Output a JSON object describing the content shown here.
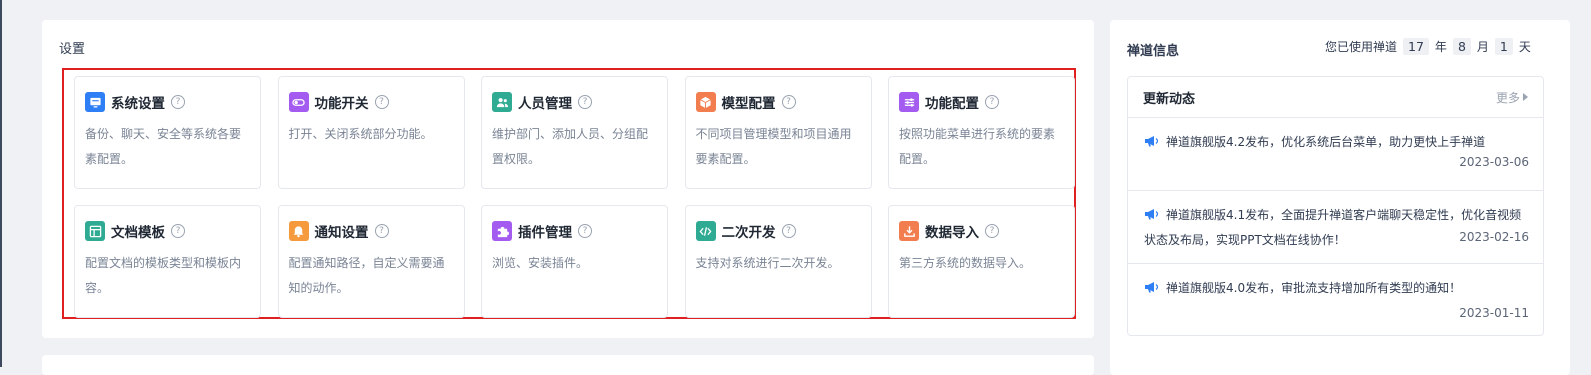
{
  "settings": {
    "title": "设置",
    "cards": [
      {
        "title": "系统设置",
        "icon": "monitor-icon",
        "color": "#2e7ef5",
        "desc": "备份、聊天、安全等系统各要素配置。"
      },
      {
        "title": "功能开关",
        "icon": "toggle-icon",
        "color": "#a45cf0",
        "desc": "打开、关闭系统部分功能。"
      },
      {
        "title": "人员管理",
        "icon": "users-icon",
        "color": "#2fab94",
        "desc": "维护部门、添加人员、分组配置权限。"
      },
      {
        "title": "模型配置",
        "icon": "cube-icon",
        "color": "#f27d4f",
        "desc": "不同项目管理模型和项目通用要素配置。"
      },
      {
        "title": "功能配置",
        "icon": "sliders-icon",
        "color": "#a45cf0",
        "desc": "按照功能菜单进行系统的要素配置。"
      },
      {
        "title": "文档模板",
        "icon": "template-icon",
        "color": "#2fab94",
        "desc": "配置文档的模板类型和模板内容。"
      },
      {
        "title": "通知设置",
        "icon": "bell-icon",
        "color": "#f59a3d",
        "desc": "配置通知路径，自定义需要通知的动作。"
      },
      {
        "title": "插件管理",
        "icon": "puzzle-icon",
        "color": "#a45cf0",
        "desc": "浏览、安装插件。"
      },
      {
        "title": "二次开发",
        "icon": "code-icon",
        "color": "#2fab94",
        "desc": "支持对系统进行二次开发。"
      },
      {
        "title": "数据导入",
        "icon": "import-icon",
        "color": "#f27d4f",
        "desc": "第三方系统的数据导入。"
      }
    ]
  },
  "side": {
    "title": "禅道信息",
    "usage_prefix": "您已使用禅道",
    "years": "17",
    "years_unit": "年",
    "months": "8",
    "months_unit": "月",
    "days": "1",
    "days_unit": "天",
    "updates_title": "更新动态",
    "more_label": "更多",
    "news": [
      {
        "text": "禅道旗舰版4.2发布，优化系统后台菜单，助力更快上手禅道",
        "date": "2023-03-06"
      },
      {
        "text": "禅道旗舰版4.1发布，全面提升禅道客户端聊天稳定性，优化音视频状态及布局，实现PPT文档在线协作！",
        "date": "2023-02-16"
      },
      {
        "text": "禅道旗舰版4.0发布，审批流支持增加所有类型的通知！",
        "date": "2023-01-11"
      }
    ],
    "news_icon": "megaphone-icon",
    "news_icon_color": "#2e7ef5"
  }
}
